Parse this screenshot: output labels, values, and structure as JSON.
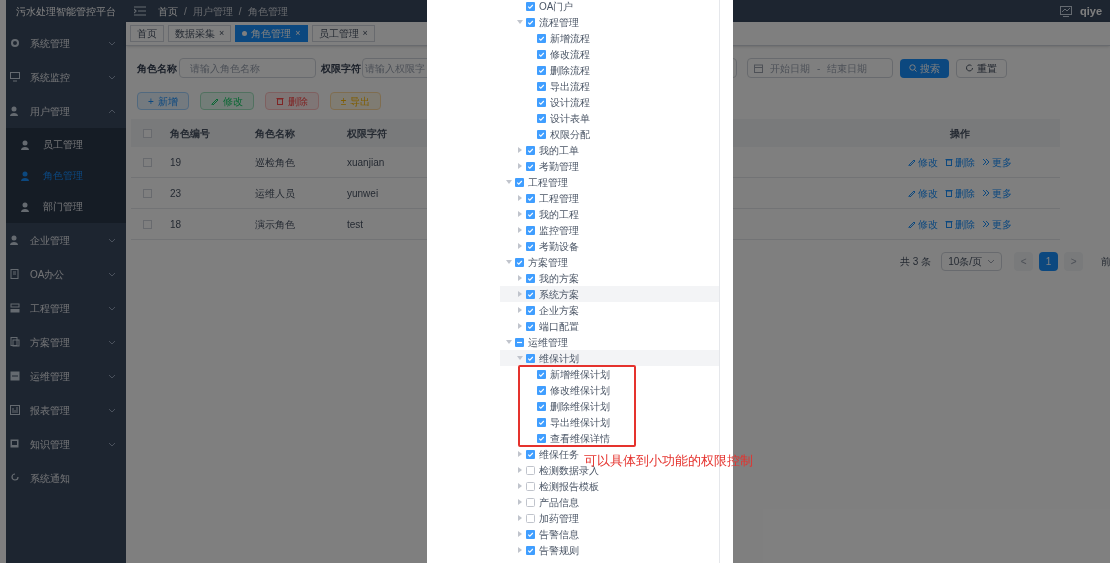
{
  "sidebar": {
    "title": "污水处理智能管控平台",
    "items": [
      {
        "label": "系统管理",
        "expanded": false
      },
      {
        "label": "系统监控",
        "expanded": false
      },
      {
        "label": "用户管理",
        "expanded": true,
        "children": [
          {
            "label": "员工管理",
            "selected": false
          },
          {
            "label": "角色管理",
            "selected": true
          },
          {
            "label": "部门管理",
            "selected": false
          }
        ]
      },
      {
        "label": "企业管理",
        "expanded": false
      },
      {
        "label": "OA办公",
        "expanded": false
      },
      {
        "label": "工程管理",
        "expanded": false
      },
      {
        "label": "方案管理",
        "expanded": false
      },
      {
        "label": "运维管理",
        "expanded": false
      },
      {
        "label": "报表管理",
        "expanded": false
      },
      {
        "label": "知识管理",
        "expanded": false
      },
      {
        "label": "系统通知"
      }
    ]
  },
  "header": {
    "breadcrumb": [
      "首页",
      "用户管理",
      "角色管理"
    ],
    "separator": "/",
    "user": "qiye"
  },
  "tabs": [
    {
      "label": "首页",
      "closable": false,
      "selected": false
    },
    {
      "label": "数据采集",
      "closable": true,
      "selected": false
    },
    {
      "label": "角色管理",
      "closable": true,
      "selected": true
    },
    {
      "label": "员工管理",
      "closable": true,
      "selected": false
    }
  ],
  "close_glyph": "×",
  "filters": {
    "role_name_label": "角色名称",
    "role_name_placeholder": "请输入角色名称",
    "perm_label": "权限字符",
    "perm_placeholder": "请输入权限字",
    "start_placeholder": "开始日期",
    "range_separator": "-",
    "end_placeholder": "结束日期",
    "search": "搜索",
    "reset": "重置"
  },
  "actions": [
    {
      "kind": "add",
      "label": "新增",
      "glyph": "+"
    },
    {
      "kind": "edit",
      "label": "修改"
    },
    {
      "kind": "delete",
      "label": "删除"
    },
    {
      "kind": "export",
      "label": "导出",
      "glyph": "±"
    }
  ],
  "table": {
    "columns": [
      "角色编号",
      "角色名称",
      "权限字符",
      "操作"
    ],
    "rows": [
      {
        "checked": false,
        "cells": [
          "19",
          "巡检角色",
          "xuanjian"
        ],
        "ops": [
          "修改",
          "删除",
          "更多"
        ]
      },
      {
        "checked": false,
        "cells": [
          "23",
          "运维人员",
          "yunwei"
        ],
        "ops": [
          "修改",
          "删除",
          "更多"
        ]
      },
      {
        "checked": false,
        "cells": [
          "18",
          "演示角色",
          "test"
        ],
        "ops": [
          "修改",
          "删除",
          "更多"
        ]
      }
    ]
  },
  "pagination": {
    "total": "共 3 条",
    "page_size": "10条/页",
    "pages": [
      {
        "label": "1",
        "selected": true
      }
    ],
    "prev": "<",
    "next": ">",
    "goto": "前"
  },
  "permission_tree": {
    "continued_children": [
      {
        "label": "OA门户",
        "checked": true,
        "indeterminate": false,
        "highlighted": false
      },
      {
        "label": "流程管理",
        "checked": true,
        "indeterminate": false,
        "expanded": true,
        "highlighted": false,
        "children": [
          {
            "label": "新增流程",
            "checked": true,
            "indeterminate": false,
            "highlighted": false
          },
          {
            "label": "修改流程",
            "checked": true,
            "indeterminate": false,
            "highlighted": false
          },
          {
            "label": "删除流程",
            "checked": true,
            "indeterminate": false,
            "highlighted": false
          },
          {
            "label": "导出流程",
            "checked": true,
            "indeterminate": false,
            "highlighted": false
          },
          {
            "label": "设计流程",
            "checked": true,
            "indeterminate": false,
            "highlighted": false
          },
          {
            "label": "设计表单",
            "checked": true,
            "indeterminate": false,
            "highlighted": false
          },
          {
            "label": "权限分配",
            "checked": true,
            "indeterminate": false,
            "highlighted": false
          }
        ]
      },
      {
        "label": "我的工单",
        "checked": true,
        "indeterminate": false,
        "expanded": false,
        "highlighted": false
      },
      {
        "label": "考勤管理",
        "checked": true,
        "indeterminate": false,
        "expanded": false,
        "highlighted": false
      }
    ],
    "nodes": [
      {
        "label": "工程管理",
        "checked": true,
        "indeterminate": false,
        "expanded": true,
        "highlighted": false,
        "children": [
          {
            "label": "工程管理",
            "checked": true,
            "indeterminate": false,
            "expanded": false,
            "highlighted": false
          },
          {
            "label": "我的工程",
            "checked": true,
            "indeterminate": false,
            "expanded": false,
            "highlighted": false
          },
          {
            "label": "监控管理",
            "checked": true,
            "indeterminate": false,
            "expanded": false,
            "highlighted": false
          },
          {
            "label": "考勤设备",
            "checked": true,
            "indeterminate": false,
            "expanded": false,
            "highlighted": false
          }
        ]
      },
      {
        "label": "方案管理",
        "checked": true,
        "indeterminate": false,
        "expanded": true,
        "highlighted": false,
        "children": [
          {
            "label": "我的方案",
            "checked": true,
            "indeterminate": false,
            "expanded": false,
            "highlighted": false
          },
          {
            "label": "系统方案",
            "checked": true,
            "indeterminate": false,
            "expanded": false,
            "highlighted": true
          },
          {
            "label": "企业方案",
            "checked": true,
            "indeterminate": false,
            "expanded": false,
            "highlighted": false
          },
          {
            "label": "端口配置",
            "checked": true,
            "indeterminate": false,
            "expanded": false,
            "highlighted": false
          }
        ]
      },
      {
        "label": "运维管理",
        "checked": false,
        "indeterminate": true,
        "expanded": true,
        "highlighted": false,
        "children": [
          {
            "label": "维保计划",
            "checked": true,
            "indeterminate": false,
            "expanded": true,
            "highlighted": true,
            "children": [
              {
                "label": "新增维保计划",
                "checked": true,
                "indeterminate": false,
                "highlighted": false
              },
              {
                "label": "修改维保计划",
                "checked": true,
                "indeterminate": false,
                "highlighted": false
              },
              {
                "label": "删除维保计划",
                "checked": true,
                "indeterminate": false,
                "highlighted": false
              },
              {
                "label": "导出维保计划",
                "checked": true,
                "indeterminate": false,
                "highlighted": false
              },
              {
                "label": "查看维保详情",
                "checked": true,
                "indeterminate": false,
                "highlighted": false
              }
            ]
          },
          {
            "label": "维保任务",
            "checked": true,
            "indeterminate": false,
            "expanded": false,
            "highlighted": false
          },
          {
            "label": "检测数据录入",
            "checked": false,
            "indeterminate": false,
            "expanded": false,
            "highlighted": false
          },
          {
            "label": "检测报告模板",
            "checked": false,
            "indeterminate": false,
            "expanded": false,
            "highlighted": false
          },
          {
            "label": "产品信息",
            "checked": false,
            "indeterminate": false,
            "expanded": false,
            "highlighted": false
          },
          {
            "label": "加药管理",
            "checked": false,
            "indeterminate": false,
            "expanded": false,
            "highlighted": false
          },
          {
            "label": "告警信息",
            "checked": true,
            "indeterminate": false,
            "expanded": false,
            "highlighted": false
          },
          {
            "label": "告警规则",
            "checked": true,
            "indeterminate": false,
            "expanded": false,
            "highlighted": false
          }
        ]
      }
    ]
  },
  "annotation": {
    "text": "可以具体到小功能的权限控制"
  }
}
